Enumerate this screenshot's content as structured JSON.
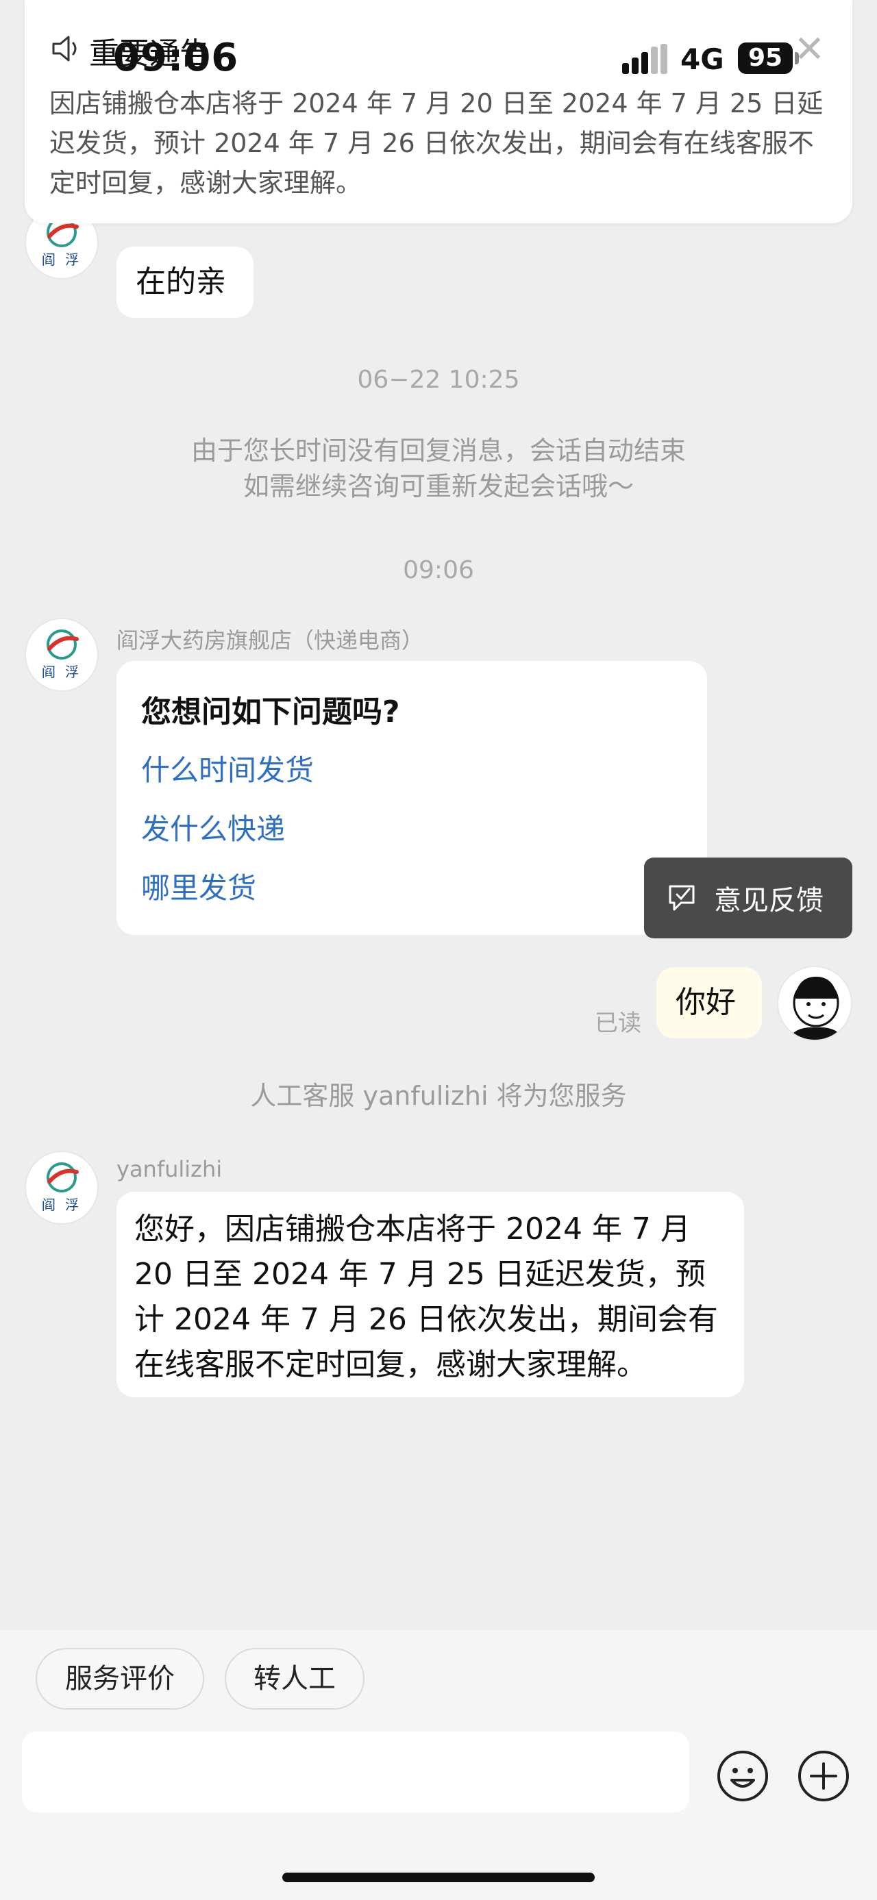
{
  "status": {
    "time": "09:06",
    "network": "4G",
    "battery": "95"
  },
  "notice": {
    "title": "重要通告",
    "body": "因店铺搬仓本店将于 2024 年 7 月 20 日至 2024 年 7 月 25 日延迟发货，预计 2024 年 7 月 26 日依次发出，期间会有在线客服不定时回复，感谢大家理解。",
    "close_icon": "close-icon"
  },
  "shop_avatar": {
    "logo_text": "阎 浮"
  },
  "messages": {
    "m1_text": "在的亲",
    "ts1": "06−22 10:25",
    "sys1_line1": "由于您长时间没有回复消息，会话自动结束",
    "sys1_line2": "如需继续咨询可重新发起会话哦～",
    "ts2": "09:06",
    "shop_name": "阎浮大药房旗舰店（快递电商）",
    "faq": {
      "title": "您想问如下问题吗?",
      "items": [
        "什么时间发货",
        "发什么快递",
        "哪里发货"
      ]
    },
    "read_status": "已读",
    "my_text": "你好",
    "sys2": "人工客服 yanfulizhi 将为您服务",
    "agent_name": "yanfulizhi",
    "agent_reply": "您好，因店铺搬仓本店将于 2024 年 7 月 20 日至 2024 年 7 月 25 日延迟发货，预计 2024 年 7 月 26 日依次发出，期间会有在线客服不定时回复，感谢大家理解。"
  },
  "feedback": {
    "label": "意见反馈"
  },
  "bottom": {
    "chips": [
      "服务评价",
      "转人工"
    ],
    "input_value": "",
    "emoji_icon": "emoji-icon",
    "plus_icon": "plus-icon"
  }
}
